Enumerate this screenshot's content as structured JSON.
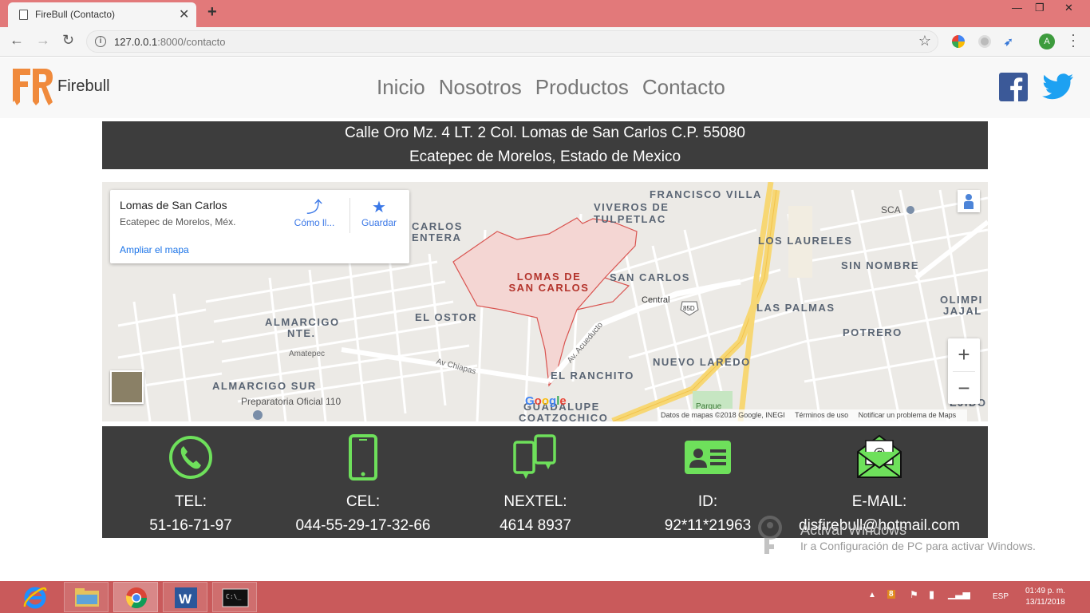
{
  "browser": {
    "tab_title": "FireBull (Contacto)",
    "tab_close": "✕",
    "new_tab": "+",
    "url_host": "127.0.0.1",
    "url_rest": ":8000/contacto",
    "profile_initial": "A",
    "window_controls": [
      "—",
      "❐",
      "✕"
    ]
  },
  "site": {
    "brand": "Firebull",
    "nav": [
      "Inicio",
      "Nosotros",
      "Productos",
      "Contacto"
    ],
    "address_line1": "Calle Oro Mz. 4 LT. 2 Col. Lomas de San Carlos C.P. 55080",
    "address_line2": "Ecatepec de Morelos, Estado de Mexico"
  },
  "map": {
    "place_title": "Lomas de San Carlos",
    "place_subtitle": "Ecatepec de Morelos, Méx.",
    "directions_label": "Cómo ll...",
    "save_label": "Guardar",
    "enlarge_link": "Ampliar el mapa",
    "zoom_in": "+",
    "zoom_out": "−",
    "google": "Google",
    "attribution": [
      "Datos de mapas ©2018 Google, INEGI",
      "Términos de uso",
      "Notificar un problema de Maps"
    ],
    "labels": {
      "francisco_villa": "FRANCISCO VILLA",
      "viveros_1": "VIVEROS DE",
      "viveros_2": "TULPETLAC",
      "carlos_1": "CARLOS",
      "carlos_2": "ENTERA",
      "los_laureles": "LOS LAURELES",
      "sin_nombre": "SIN NOMBRE",
      "olimpi_1": "OLIMPI",
      "olimpi_2": "JAJAL",
      "lomas_1": "LOMAS DE",
      "lomas_2": "SAN CARLOS",
      "san_carlos": "SAN CARLOS",
      "central": "Central",
      "las_palmas": "LAS PALMAS",
      "almarcigo_1": "ALMARCIGO",
      "almarcigo_2": "NTE.",
      "el_ostor": "EL OSTOR",
      "potrero": "POTRERO",
      "el_ranchito": "EL RANCHITO",
      "nuevo_laredo": "NUEVO LAREDO",
      "almarcigo_sur": "ALMARCIGO SUR",
      "preparatoria": "Preparatoria Oficial 110",
      "guadalupe": "GUADALUPE",
      "coatzochico": "COATZOCHICO",
      "ejido": "EJIDO D",
      "sca": "SCA",
      "amatepec": "Amatepec",
      "av_chiapas": "Av Chiapas",
      "av_acueducto": "Av. Acueducto",
      "route_85d": "85D",
      "parque": "Parque"
    }
  },
  "contacts": [
    {
      "label": "TEL:",
      "value": "51-16-71-97",
      "icon": "phone-icon"
    },
    {
      "label": "CEL:",
      "value": "044-55-29-17-32-66",
      "icon": "mobile-icon"
    },
    {
      "label": "NEXTEL:",
      "value": "4614 8937",
      "icon": "nextel-icon"
    },
    {
      "label": "ID:",
      "value": "92*11*21963",
      "icon": "id-card-icon"
    },
    {
      "label": "E-MAIL:",
      "value": "disfirebull@hotmail.com",
      "icon": "email-icon"
    }
  ],
  "watermark": {
    "title": "Activar Windows",
    "text": "Ir a Configuración de PC para activar Windows."
  },
  "taskbar": {
    "language": "ESP",
    "time": "01:49 p. m.",
    "date": "13/11/2018"
  },
  "colors": {
    "accent_green": "#6ee05b",
    "dark_band": "#3d3d3d",
    "chrome_titlebar": "#e2797a",
    "taskbar": "#c95a5b",
    "facebook": "#3b5998",
    "twitter": "#1da1f2"
  }
}
